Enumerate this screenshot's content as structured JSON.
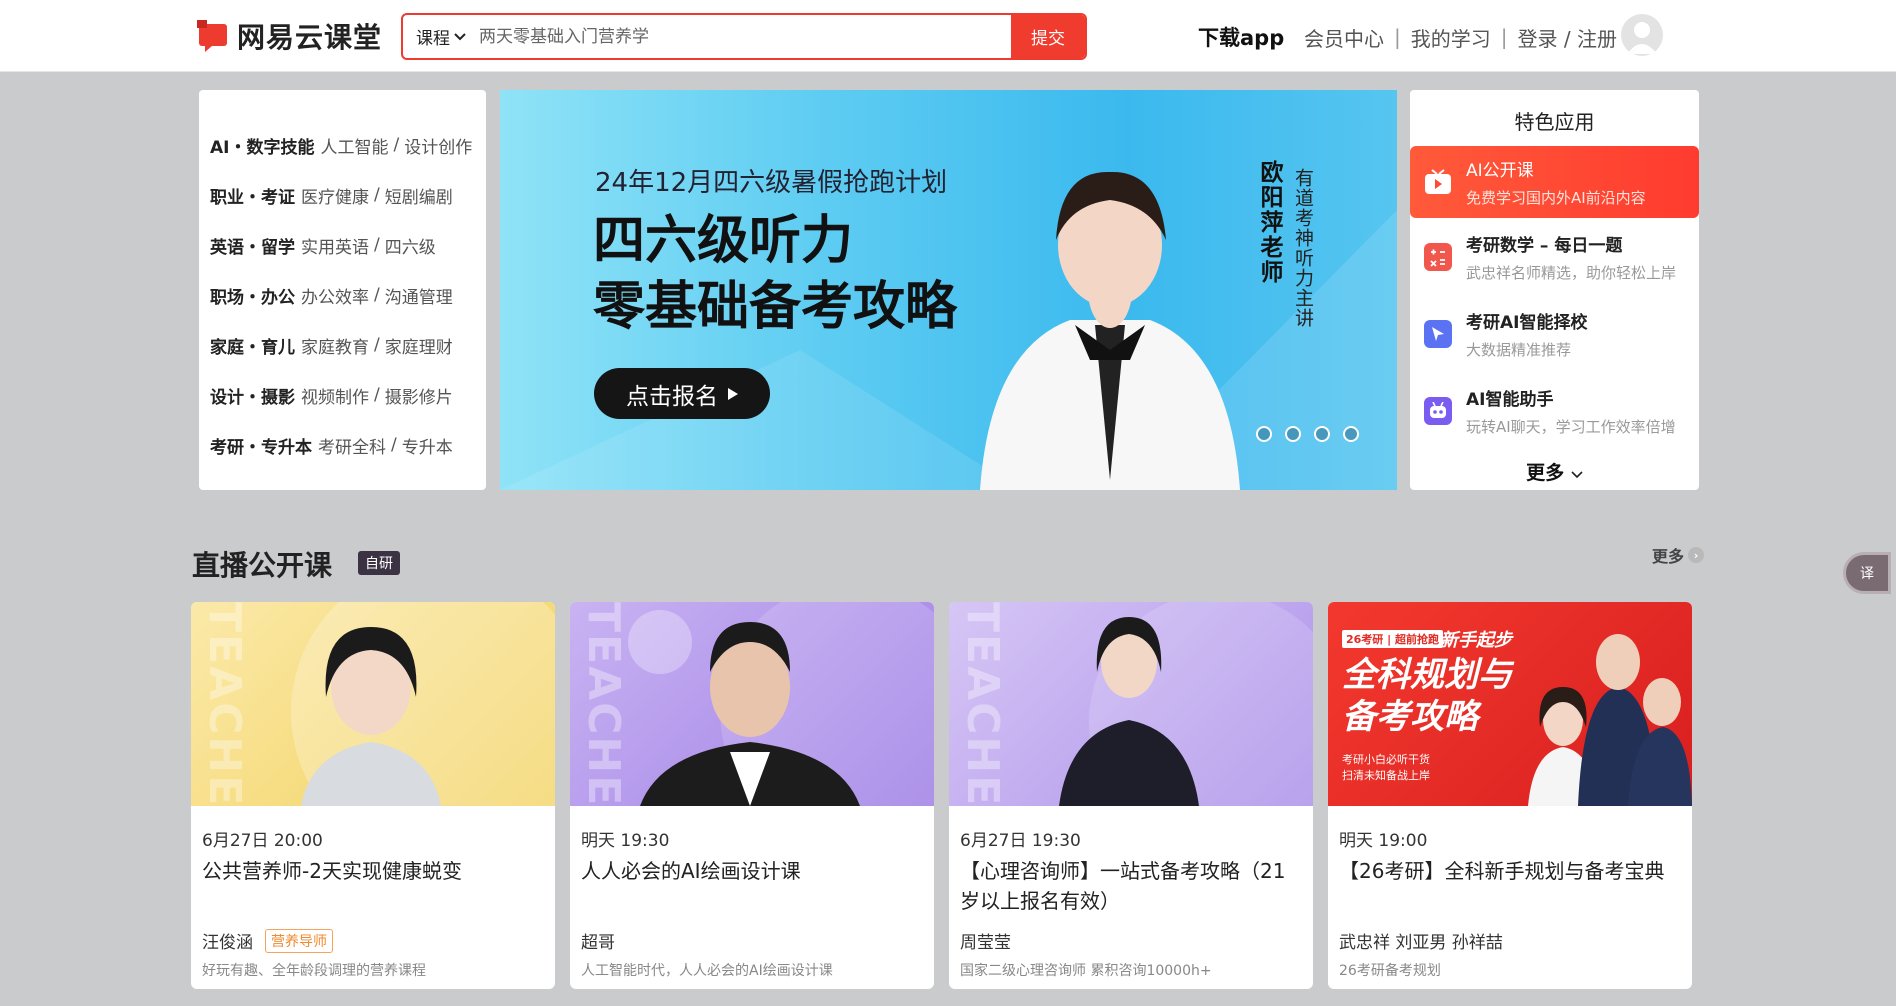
{
  "header": {
    "logo_text": "网易云课堂",
    "search_type": "课程",
    "search_placeholder": "两天零基础入门营养学",
    "search_button": "提交",
    "download": "下载app",
    "member_center": "会员中心",
    "my_learning": "我的学习",
    "login": "登录 / 注册",
    "sep": "|"
  },
  "categories": [
    {
      "main": "AI・数字技能",
      "sub1": "人工智能",
      "sub2": "设计创作"
    },
    {
      "main": "职业・考证",
      "sub1": "医疗健康",
      "sub2": "短剧编剧"
    },
    {
      "main": "英语・留学",
      "sub1": "实用英语",
      "sub2": "四六级"
    },
    {
      "main": "职场・办公",
      "sub1": "办公效率",
      "sub2": "沟通管理"
    },
    {
      "main": "家庭・育儿",
      "sub1": "家庭教育",
      "sub2": "家庭理财"
    },
    {
      "main": "设计・摄影",
      "sub1": "视频制作",
      "sub2": "摄影修片"
    },
    {
      "main": "考研・专升本",
      "sub1": "考研全科",
      "sub2": "专升本"
    }
  ],
  "banner": {
    "subtitle": "24年12月四六级暑假抢跑计划",
    "title_line1": "四六级听力",
    "title_line2": "零基础备考攻略",
    "button": "点击报名",
    "teacher_name": "欧阳萍老师",
    "teacher_desc": "有道考神听力主讲",
    "dots": 4,
    "active_dot": 0
  },
  "featured": {
    "title": "特色应用",
    "items": [
      {
        "name": "AI公开课",
        "desc": "免费学习国内外AI前沿内容",
        "icon": "tv-play-icon",
        "color": "#ffffff"
      },
      {
        "name": "考研数学 – 每日一题",
        "desc": "武忠祥名师精选，助你轻松上岸",
        "icon": "calculator-icon",
        "color": "#f1574d"
      },
      {
        "name": "考研AI智能择校",
        "desc": "大数据精准推荐",
        "icon": "cursor-icon",
        "color": "#5b72f2"
      },
      {
        "name": "AI智能助手",
        "desc": "玩转AI聊天，学习工作效率倍增",
        "icon": "robot-icon",
        "color": "#7b5cf0"
      }
    ],
    "more": "更多"
  },
  "live": {
    "title": "直播公开课",
    "badge": "自研",
    "more": "更多",
    "cards": [
      {
        "time": "6月27日 20:00",
        "title": "公共营养师-2天实现健康蜕变",
        "teacher": "汪俊涵",
        "tag": "营养导师",
        "desc": "好玩有趣、全年龄段调理的营养课程"
      },
      {
        "time": "明天 19:30",
        "title": "人人必会的AI绘画设计课",
        "teacher": "超哥",
        "tag": "",
        "desc": "人工智能时代，人人必会的AI绘画设计课"
      },
      {
        "time": "6月27日 19:30",
        "title": "【心理咨询师】一站式备考攻略（21岁以上报名有效）",
        "teacher": "周莹莹",
        "tag": "",
        "desc": "国家二级心理咨询师 累积咨询10000h+"
      },
      {
        "time": "明天 19:00",
        "title": "【26考研】全科新手规划与备考宝典",
        "teacher": "武忠祥 刘亚男 孙祥喆",
        "tag": "",
        "desc": "26考研备考规划"
      }
    ],
    "card4_banner": {
      "badge": "26考研 | 超前抢跑",
      "headline_small": "新手起步",
      "headline1": "全科规划与",
      "headline2": "备考攻略",
      "note1": "考研小白必听干货",
      "note2": "扫清未知备战上岸"
    },
    "watermark": "TEACHER"
  },
  "translate_label": "译"
}
